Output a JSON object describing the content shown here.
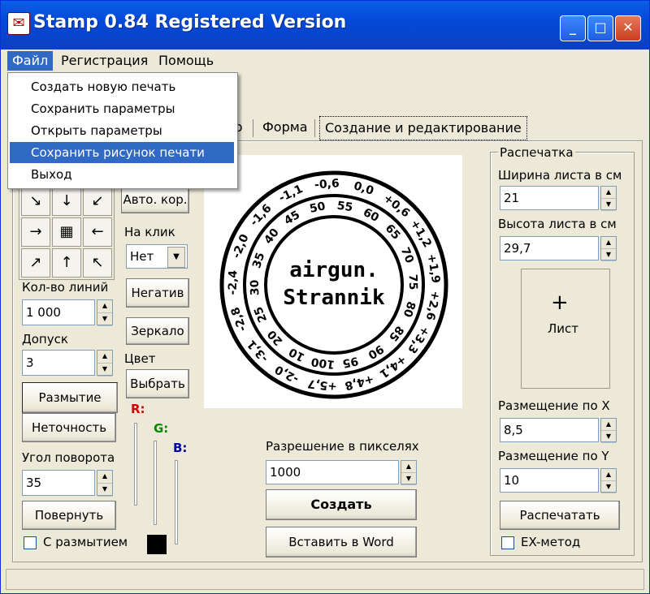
{
  "window": {
    "title": "Stamp 0.84 Registered Version",
    "icon_text": "✉"
  },
  "window_buttons": {
    "minimize": "_",
    "maximize": "□",
    "close": "✕"
  },
  "menu": {
    "items": [
      "Файл",
      "Регистрация",
      "Помощь"
    ]
  },
  "file_menu": {
    "items": [
      "Создать новую печать",
      "Сохранить параметры",
      "Открыть параметры",
      "Сохранить рисунок печати",
      "Выход"
    ]
  },
  "tabs": [
    "тр",
    "Форма",
    "Создание и редактирование"
  ],
  "left": {
    "arrows": [
      "↘",
      "↓",
      "↙",
      "→",
      "▦",
      "←",
      "↗",
      "↑",
      "↖"
    ],
    "lines_label": "Кол-во линий",
    "lines_value": "1 000",
    "tolerance_label": "Допуск",
    "tolerance_value": "3",
    "blur_button": "Размытие",
    "inaccuracy_button": "Неточность",
    "angle_label": "Угол поворота",
    "angle_value": "35",
    "rotate_button": "Повернуть",
    "blur_check_label": "С размытием"
  },
  "middle_left": {
    "auto_btn": "Авто. кор.",
    "on_click_label": "На клик",
    "on_click_value": "Нет",
    "negative_btn": "Негатив",
    "mirror_btn": "Зеркало",
    "color_label": "Цвет",
    "choose_btn": "Выбрать",
    "r_label": "R:",
    "g_label": "G:",
    "b_label": "B:"
  },
  "stamp": {
    "line1": "airgun.",
    "line2": "Strannik",
    "outer_numbers": [
      "-0,6",
      "0,0",
      "+0,6",
      "+1,2",
      "+1,9",
      "+2,6",
      "+3,3",
      "+4,1",
      "+4,8",
      "+5,7",
      "-2,0",
      "-3,1",
      "-2,8",
      "-2,4",
      "-2,0",
      "-1,6",
      "-1,1"
    ],
    "inner_numbers": [
      "50",
      "55",
      "60",
      "65",
      "70",
      "75",
      "80",
      "85",
      "90",
      "95",
      "100",
      "10",
      "20",
      "25",
      "30",
      "35",
      "40",
      "45"
    ]
  },
  "center": {
    "resolution_label": "Разрешение в пикселях",
    "resolution_value": "1000",
    "create_btn": "Создать",
    "insert_btn": "Вставить в Word"
  },
  "print": {
    "group_label": "Распечатка",
    "width_label": "Ширина листа в см",
    "width_value": "21",
    "height_label": "Высота листа в см",
    "height_value": "29,7",
    "sheet_label": "Лист",
    "pos_x_label": "Размещение по X",
    "pos_x_value": "8,5",
    "pos_y_label": "Размещение по Y",
    "pos_y_value": "10",
    "print_btn": "Распечатать",
    "ex_label": "EX-метод"
  },
  "colors": {
    "accent": "#316ac5",
    "title": "#0449d9",
    "r": "#cc0000",
    "g": "#008800",
    "b": "#0000aa"
  }
}
